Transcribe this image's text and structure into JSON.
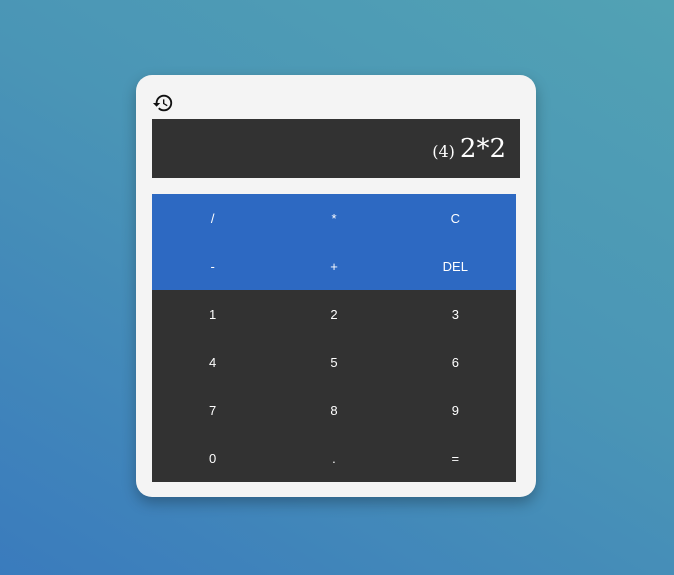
{
  "header": {
    "history_icon": "history-icon"
  },
  "display": {
    "result": "(4)",
    "expression": "2*2"
  },
  "keypad": {
    "rows": [
      [
        "/",
        "*",
        "C"
      ],
      [
        "-",
        "+",
        "DEL"
      ],
      [
        "1",
        "2",
        "3"
      ],
      [
        "4",
        "5",
        "6"
      ],
      [
        "7",
        "8",
        "9"
      ],
      [
        "0",
        ".",
        "="
      ]
    ]
  },
  "colors": {
    "operator_keys": "#2d69c2",
    "digit_keys": "#323232",
    "display_bg": "#323232",
    "card_bg": "#f4f4f4"
  }
}
